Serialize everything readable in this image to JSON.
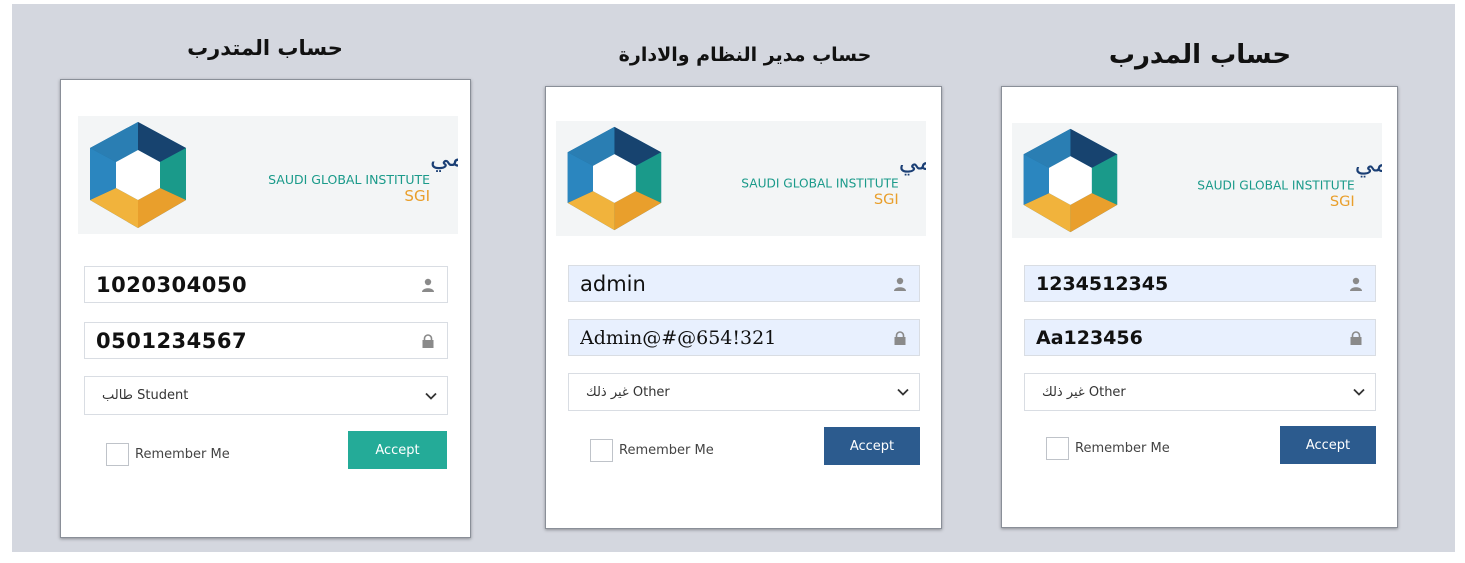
{
  "colors": {
    "page_background": "#d4d7df",
    "input_autofill_background": "#e8f0fe",
    "accept_teal": "#24ab98",
    "accept_navy": "#2c5b8e"
  },
  "logo": {
    "arabic_name": "المعهد السعودي العالمي",
    "english_name": "SAUDI GLOBAL INSTITUTE",
    "abbreviation": "SGI"
  },
  "panels": [
    {
      "title": "حساب المتدرب",
      "username": "1020304050",
      "password": "0501234567",
      "account_type": "طالب Student",
      "remember_label": "Remember Me",
      "accept_label": "Accept"
    },
    {
      "title": "حساب مدير النظام والادارة",
      "username": "admin",
      "password": "Admin@#@654!321",
      "account_type": "غير ذلك Other",
      "remember_label": "Remember Me",
      "accept_label": "Accept"
    },
    {
      "title": "حساب المدرب",
      "username": "1234512345",
      "password": "Aa123456",
      "account_type": "غير ذلك Other",
      "remember_label": "Remember Me",
      "accept_label": "Accept"
    }
  ],
  "icons": {
    "username": "user-icon",
    "password": "lock-icon",
    "select": "chevron-down-icon"
  }
}
